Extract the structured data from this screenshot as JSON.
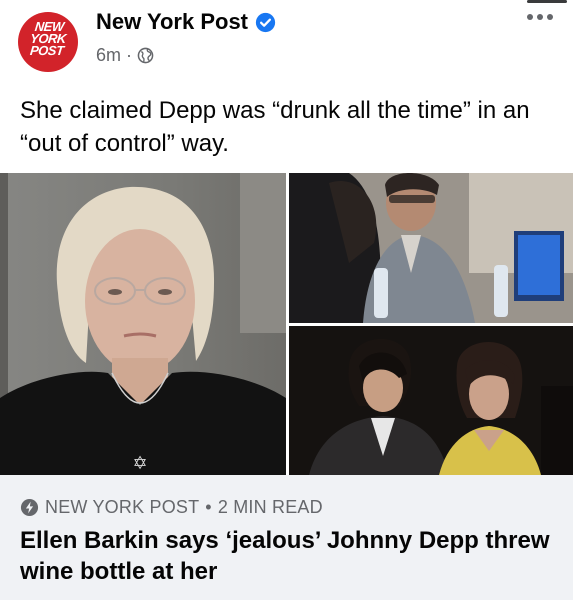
{
  "post": {
    "page_name": "New York Post",
    "verified": true,
    "avatar_logo_lines": [
      "NEW",
      "YORK",
      "POST"
    ],
    "timestamp": "6m",
    "separator": "·",
    "privacy_icon": "globe-icon",
    "more_icon": "more-horizontal-icon",
    "caption": "She claimed Depp was “drunk all the time” in an “out of control” way."
  },
  "link_preview": {
    "source_icon": "bolt-icon",
    "source": "NEW YORK POST",
    "bullet": "•",
    "read_time": "2 MIN READ",
    "title": "Ellen Barkin says ‘jealous’ Johnny Depp threw wine bottle at her"
  },
  "colors": {
    "brand_red": "#d2232a",
    "verified_blue": "#1877f2",
    "secondary_text": "#65676b",
    "link_box_bg": "#f0f2f5"
  }
}
